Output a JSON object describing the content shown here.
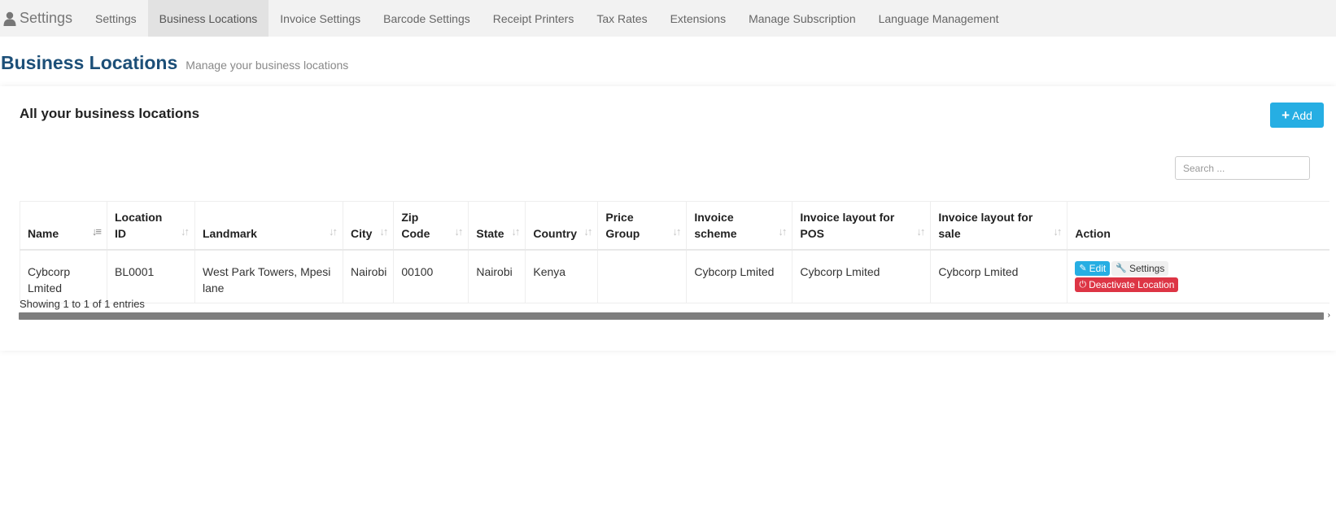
{
  "brand": {
    "label": "Settings",
    "icon": "user-icon"
  },
  "nav": {
    "items": [
      {
        "label": "Settings",
        "active": false
      },
      {
        "label": "Business Locations",
        "active": true
      },
      {
        "label": "Invoice Settings",
        "active": false
      },
      {
        "label": "Barcode Settings",
        "active": false
      },
      {
        "label": "Receipt Printers",
        "active": false
      },
      {
        "label": "Tax Rates",
        "active": false
      },
      {
        "label": "Extensions",
        "active": false
      },
      {
        "label": "Manage Subscription",
        "active": false
      },
      {
        "label": "Language Management",
        "active": false
      }
    ]
  },
  "page": {
    "title": "Business Locations",
    "subtitle": "Manage your business locations"
  },
  "box": {
    "title": "All your business locations",
    "add_label": "Add",
    "search_placeholder": "Search ..."
  },
  "table": {
    "columns": [
      {
        "line1": "Name",
        "line2": ""
      },
      {
        "line1": "Location",
        "line2": "ID"
      },
      {
        "line1": "Landmark",
        "line2": ""
      },
      {
        "line1": "City",
        "line2": ""
      },
      {
        "line1": "Zip",
        "line2": "Code"
      },
      {
        "line1": "State",
        "line2": ""
      },
      {
        "line1": "Country",
        "line2": ""
      },
      {
        "line1": "Price",
        "line2": "Group"
      },
      {
        "line1": "Invoice",
        "line2": "scheme"
      },
      {
        "line1": "Invoice layout for",
        "line2": "POS"
      },
      {
        "line1": "Invoice layout for",
        "line2": "sale"
      },
      {
        "line1": "Action",
        "line2": ""
      }
    ],
    "rows": [
      {
        "name": "Cybcorp Lmited",
        "location_id": "BL0001",
        "landmark": "West Park Towers, Mpesi lane",
        "city": "Nairobi",
        "zip": "00100",
        "state": "Nairobi",
        "country": "Kenya",
        "price_group": "",
        "invoice_scheme": "Cybcorp Lmited",
        "layout_pos": "Cybcorp Lmited",
        "layout_sale": "Cybcorp Lmited",
        "actions": {
          "edit": "Edit",
          "settings": "Settings",
          "deactivate": "Deactivate Location"
        }
      }
    ]
  },
  "info": "Showing 1 to 1 of 1 entries",
  "colors": {
    "accent": "#26aee3",
    "danger": "#dd3545",
    "title": "#1c4f78"
  }
}
